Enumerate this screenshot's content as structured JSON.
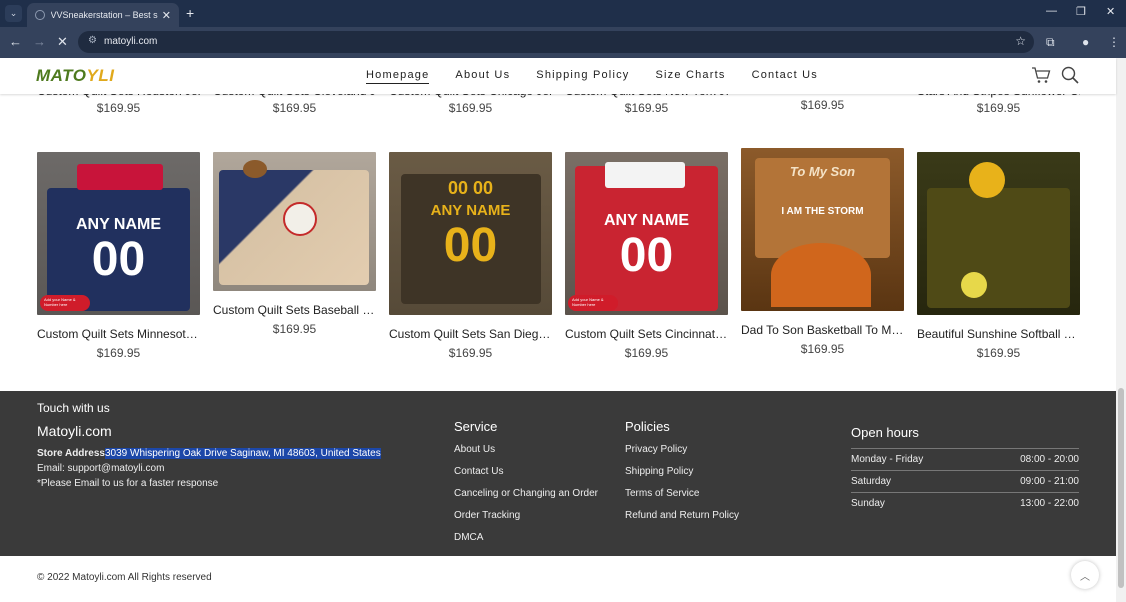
{
  "browser": {
    "tab_title": "VVSneakerstation – Best sneake",
    "url": "matoyli.com"
  },
  "header": {
    "logo_text_a": "MATO",
    "logo_text_b": "YLI",
    "nav": [
      "Homepage",
      "About Us",
      "Shipping Policy",
      "Size Charts",
      "Contact Us"
    ]
  },
  "top_row": {
    "names": [
      "Custom Quilt Sets Houston Jerse...",
      "Custom Quilt Sets Cleveland Jerse...",
      "Custom Quilt Sets Chicago Jerse...",
      "Custom Quilt Sets New York Jerse...",
      "",
      "Stars And Stripes Sunflower Cust..."
    ],
    "prices": [
      "$169.95",
      "$169.95",
      "$169.95",
      "$169.95",
      "$169.95",
      "$169.95"
    ]
  },
  "products": [
    {
      "name": "Custom Quilt Sets Minnesota Jer...",
      "price": "$169.95",
      "image_text_1": "ANY NAME",
      "image_text_2": "00",
      "image_text_3": "Add your Name & Number here"
    },
    {
      "name": "Custom Quilt Sets Baseball Playe...",
      "price": "$169.95"
    },
    {
      "name": "Custom Quilt Sets San Diego Jer...",
      "price": "$169.95",
      "image_text_1": "00 00",
      "image_text_2": "ANY NAME",
      "image_text_3": "00"
    },
    {
      "name": "Custom Quilt Sets Cincinnati Jers...",
      "price": "$169.95",
      "image_text_1": "ANY NAME",
      "image_text_2": "00",
      "image_text_3": "Add your Name & Number here"
    },
    {
      "name": "Dad To Son Basketball To My So...",
      "price": "$169.95",
      "image_text_1": "To My Son",
      "image_text_2": "I AM THE STORM"
    },
    {
      "name": "Beautiful Sunshine Softball You ...",
      "price": "$169.95"
    }
  ],
  "footer": {
    "touch": "Touch with us",
    "brand": "Matoyli.com",
    "address_label": "Store Address :",
    "address": "3039 Whispering Oak Drive Saginaw, MI 48603, United States",
    "email": "Email: support@matoyli.com",
    "note": "*Please Email to us for a faster response",
    "service_title": "Service",
    "service_links": [
      "About Us",
      "Contact Us",
      "Canceling or Changing an Order",
      "Order Tracking",
      "DMCA"
    ],
    "policies_title": "Policies",
    "policy_links": [
      "Privacy Policy",
      "Shipping Policy",
      "Terms of Service",
      "Refund and Return Policy"
    ],
    "hours_title": "Open hours",
    "hours": [
      {
        "day": "Monday - Friday",
        "time": "08:00 - 20:00"
      },
      {
        "day": "Saturday",
        "time": "09:00 - 21:00"
      },
      {
        "day": "Sunday",
        "time": "13:00 - 22:00"
      }
    ]
  },
  "copyright": "© 2022 Matoyli.com All Rights reserved",
  "icons": {
    "cart": "cart-icon",
    "search": "search-icon",
    "back_to_top": "chevron-up-icon"
  },
  "colors": {
    "footer_bg": "#3a3a3a",
    "highlight": "#1c47a8",
    "browser_dark": "#1f2f4a"
  }
}
